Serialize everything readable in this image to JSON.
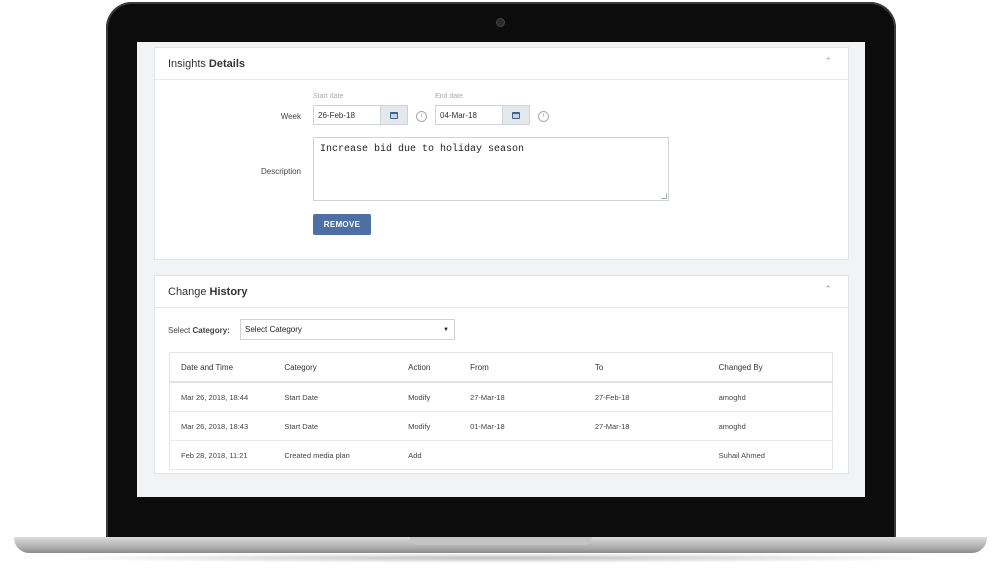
{
  "insights": {
    "title_prefix": "Insights",
    "title_bold": "Details",
    "week_label": "Week",
    "start_caption": "Start date",
    "start_value": "26-Feb-18",
    "end_caption": "End date",
    "end_value": "04-Mar-18",
    "info_glyph": "i",
    "description_label": "Description",
    "description_value": "Increase bid due to holiday season",
    "remove_label": "REMOVE"
  },
  "history": {
    "title_prefix": "Change",
    "title_bold": "History",
    "select_prefix": "Select",
    "select_bold": "Category:",
    "select_value": "Select Category",
    "columns": [
      "Date and Time",
      "Category",
      "Action",
      "From",
      "To",
      "Changed By"
    ],
    "rows": [
      [
        "Mar 26, 2018, 18:44",
        "Start Date",
        "Modify",
        "27-Mar-18",
        "27-Feb-18",
        "amoghd"
      ],
      [
        "Mar 26, 2018, 18:43",
        "Start Date",
        "Modify",
        "01-Mar-18",
        "27-Mar-18",
        "amoghd"
      ],
      [
        "Feb 28, 2018, 11:21",
        "Created media plan",
        "Add",
        "",
        "",
        "Suhail Ahmed"
      ]
    ]
  },
  "icons": {
    "collapse": "chevron-up-icon",
    "calendar": "calendar-icon",
    "info": "info-icon",
    "dropdown": "caret-down-icon"
  },
  "colors": {
    "primary_button": "#4e6fa3",
    "screen_bg": "#f1f3f5"
  }
}
